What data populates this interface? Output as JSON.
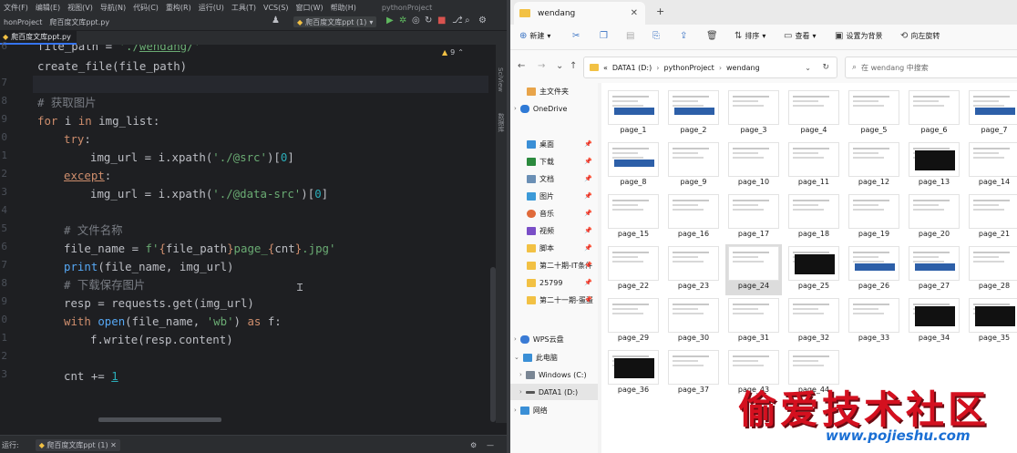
{
  "ide": {
    "menu": [
      "文件(F)",
      "编辑(E)",
      "视图(V)",
      "导航(N)",
      "代码(C)",
      "重构(R)",
      "运行(U)",
      "工具(T)",
      "VCS(S)",
      "窗口(W)",
      "帮助(H)"
    ],
    "project_title": "pythonProject",
    "breadcrumb_project": "honProject",
    "breadcrumb_file": "爬百度文库ppt.py",
    "run_config": "爬百度文库ppt (1)",
    "editor_tab": "爬百度文库ppt.py",
    "warning_count": "9",
    "right_tools": [
      "数据库",
      "SciView"
    ],
    "run_tab_prefix": "运行:",
    "run_tab": "爬百度文库ppt (1)",
    "line_numbers": [
      "6",
      "",
      "7",
      "8",
      "9",
      "0",
      "1",
      "2",
      "3",
      "4",
      "5",
      "6",
      "7",
      "8",
      "9",
      "0",
      "1",
      "2",
      "3"
    ]
  },
  "explorer": {
    "window_tab": "wendang",
    "toolbar": {
      "new": "新建",
      "sort": "排序",
      "view": "查看",
      "set_bg": "设置为背景",
      "rotate": "向左旋转"
    },
    "address": {
      "prefix": "«",
      "seg1": "DATA1 (D:)",
      "seg2": "pythonProject",
      "seg3": "wendang"
    },
    "search_placeholder": "在 wendang 中搜索",
    "sidebar": [
      "主文件夹",
      "OneDrive",
      "桌面",
      "下载",
      "文档",
      "图片",
      "音乐",
      "视频",
      "脚本",
      "第二十期-IT条件",
      "25799",
      "第二十一期-蛋蛋",
      "WPS云盘",
      "此电脑",
      "Windows (C:)",
      "DATA1 (D:)",
      "网络"
    ],
    "files": [
      "page_1",
      "page_2",
      "page_3",
      "page_4",
      "page_5",
      "page_6",
      "page_7",
      "page_8",
      "page_9",
      "page_10",
      "page_11",
      "page_12",
      "page_13",
      "page_14",
      "page_15",
      "page_16",
      "page_17",
      "page_18",
      "page_19",
      "page_20",
      "page_21",
      "page_22",
      "page_23",
      "page_24",
      "page_25",
      "page_26",
      "page_27",
      "page_28",
      "page_29",
      "page_30",
      "page_31",
      "page_32",
      "page_33",
      "page_34",
      "page_35",
      "page_36",
      "page_37",
      "page_43",
      "page_44"
    ],
    "selected_file": "page_24"
  },
  "watermark": {
    "cn": "偷爱技术社区",
    "url": "www.pojieshu.com"
  }
}
